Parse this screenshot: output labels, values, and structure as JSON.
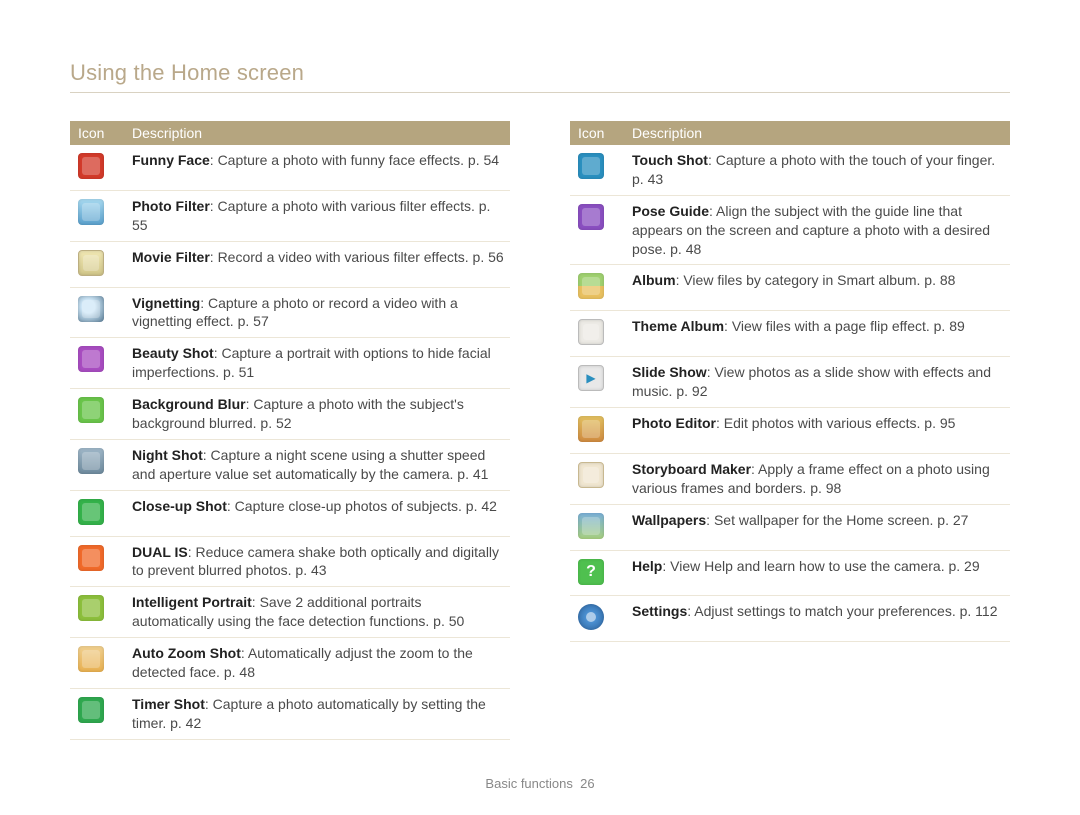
{
  "page_title": "Using the Home screen",
  "table_headers": {
    "icon": "Icon",
    "desc": "Description"
  },
  "footer": {
    "section": "Basic functions",
    "page": "26"
  },
  "left": [
    {
      "icon": "i-funnyface",
      "name": "funny-face-icon",
      "title": "Funny Face",
      "text": ": Capture a photo with funny face effects. p. 54"
    },
    {
      "icon": "i-photofilter",
      "name": "photo-filter-icon",
      "title": "Photo Filter",
      "text": ": Capture a photo with various filter effects. p. 55"
    },
    {
      "icon": "i-moviefilter",
      "name": "movie-filter-icon",
      "title": "Movie Filter",
      "text": ": Record a video with various filter effects. p. 56"
    },
    {
      "icon": "i-vignetting",
      "name": "vignetting-icon",
      "title": "Vignetting",
      "text": ": Capture a photo or record a video with a vignetting effect. p. 57"
    },
    {
      "icon": "i-beauty",
      "name": "beauty-shot-icon",
      "title": "Beauty Shot",
      "text": ": Capture a portrait with options to hide facial imperfections. p. 51"
    },
    {
      "icon": "i-bgblur",
      "name": "background-blur-icon",
      "title": "Background Blur",
      "text": ": Capture a photo with the subject's background blurred. p. 52"
    },
    {
      "icon": "i-night",
      "name": "night-shot-icon",
      "title": "Night Shot",
      "text": ": Capture a night scene using a shutter speed and aperture value set automatically by the camera. p. 41"
    },
    {
      "icon": "i-closeup",
      "name": "close-up-shot-icon",
      "title": "Close-up Shot",
      "text": ": Capture close-up photos of subjects. p. 42"
    },
    {
      "icon": "i-dualis",
      "name": "dual-is-icon",
      "title": "DUAL IS",
      "text": ": Reduce camera shake both optically and digitally to prevent blurred photos. p. 43"
    },
    {
      "icon": "i-portrait",
      "name": "intelligent-portrait-icon",
      "title": "Intelligent Portrait",
      "text": ": Save 2 additional portraits automatically using the face detection functions. p. 50"
    },
    {
      "icon": "i-autozoom",
      "name": "auto-zoom-shot-icon",
      "title": "Auto Zoom Shot",
      "text": ": Automatically adjust the zoom to the detected face. p. 48"
    },
    {
      "icon": "i-timer",
      "name": "timer-shot-icon",
      "title": "Timer Shot",
      "text": ": Capture a photo automatically by setting the timer. p. 42"
    }
  ],
  "right": [
    {
      "icon": "i-touchshot",
      "name": "touch-shot-icon",
      "title": "Touch Shot",
      "text": ": Capture a photo with the touch of your finger. p. 43"
    },
    {
      "icon": "i-poseguide",
      "name": "pose-guide-icon",
      "title": "Pose Guide",
      "text": ": Align the subject with the guide line that appears on the screen and capture a photo with a desired pose. p. 48"
    },
    {
      "icon": "i-album",
      "name": "album-icon",
      "title": "Album",
      "text": ": View files by category in Smart album. p. 88"
    },
    {
      "icon": "i-themealbum",
      "name": "theme-album-icon",
      "title": "Theme Album",
      "text": ": View files with a page flip effect. p. 89"
    },
    {
      "icon": "i-slideshow",
      "name": "slide-show-icon",
      "title": "Slide Show",
      "text": ": View photos as a slide show with effects and music. p. 92"
    },
    {
      "icon": "i-photoeditor",
      "name": "photo-editor-icon",
      "title": "Photo Editor",
      "text": ": Edit photos with various effects. p. 95"
    },
    {
      "icon": "i-storyboard",
      "name": "storyboard-maker-icon",
      "title": "Storyboard Maker",
      "text": ": Apply a frame effect on a photo using various frames and borders. p. 98"
    },
    {
      "icon": "i-wallpapers",
      "name": "wallpapers-icon",
      "title": "Wallpapers",
      "text": ": Set wallpaper for the Home screen. p. 27"
    },
    {
      "icon": "i-help",
      "name": "help-icon",
      "title": "Help",
      "text": ": View Help and learn how to use the camera. p. 29"
    },
    {
      "icon": "i-settings",
      "name": "settings-icon",
      "title": "Settings",
      "text": ": Adjust settings to match your preferences. p. 112"
    }
  ]
}
